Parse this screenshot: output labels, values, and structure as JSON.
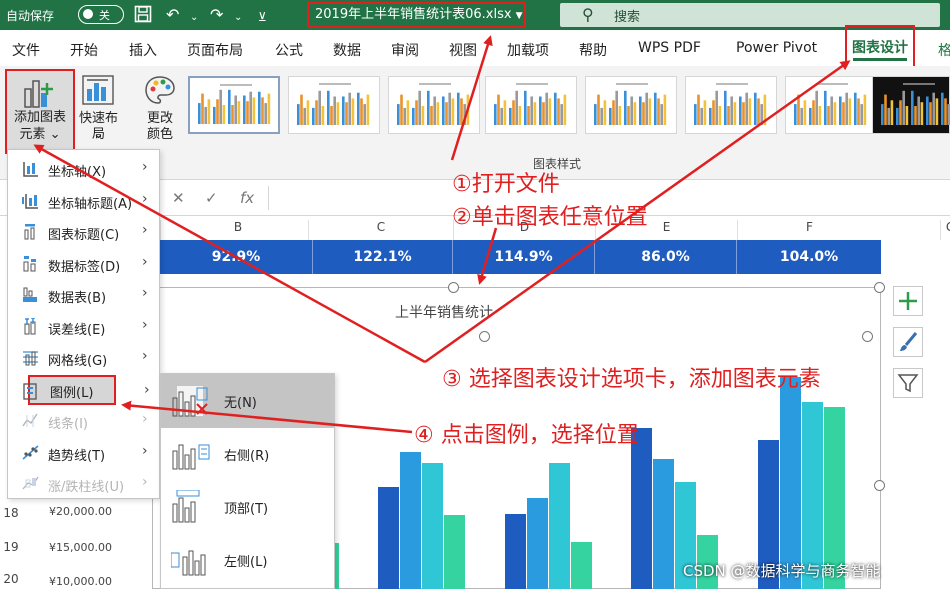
{
  "titlebar": {
    "autosave_label": "自动保存",
    "autosave_state": "关",
    "filename": "2019年上半年销售统计表06.xlsx",
    "search_placeholder": "搜索"
  },
  "tabs": [
    "文件",
    "开始",
    "插入",
    "页面布局",
    "公式",
    "数据",
    "审阅",
    "视图",
    "加载项",
    "帮助",
    "WPS PDF",
    "Power Pivot"
  ],
  "active_tab": "图表设计",
  "partial_tab": "格",
  "ribbon": {
    "add_element_label_line1": "添加图表",
    "add_element_label_line2": "元素",
    "quick_layout_label": "快速布局",
    "change_color_line1": "更改",
    "change_color_line2": "颜色",
    "styles_group_label": "图表样式"
  },
  "formula_bar": {
    "cancel_symbol": "✕",
    "confirm_symbol": "✓",
    "fx_symbol": "fx"
  },
  "sheet": {
    "column_headers": [
      "B",
      "C",
      "D",
      "E",
      "F",
      "G"
    ],
    "row_values": [
      "92.9%",
      "122.1%",
      "114.9%",
      "86.0%",
      "104.0%"
    ],
    "row_numbers": [
      "18",
      "19",
      "20"
    ],
    "y_axis_ticks": [
      "¥20,000.00",
      "¥15,000.00",
      "¥10,000.00"
    ]
  },
  "chart": {
    "title": "上半年销售统计",
    "bar_colors": [
      "#1f5cc0",
      "#2b9be0",
      "#2fc6d6",
      "#34d3a0"
    ]
  },
  "dropdown": {
    "items": [
      {
        "label": "坐标轴(X)",
        "icon": "axis-icon",
        "enabled": true
      },
      {
        "label": "坐标轴标题(A)",
        "icon": "axis-title-icon",
        "enabled": true
      },
      {
        "label": "图表标题(C)",
        "icon": "chart-title-icon",
        "enabled": true
      },
      {
        "label": "数据标签(D)",
        "icon": "data-label-icon",
        "enabled": true
      },
      {
        "label": "数据表(B)",
        "icon": "data-table-icon",
        "enabled": true
      },
      {
        "label": "误差线(E)",
        "icon": "error-bar-icon",
        "enabled": true
      },
      {
        "label": "网格线(G)",
        "icon": "gridlines-icon",
        "enabled": true
      },
      {
        "label": "图例(L)",
        "icon": "legend-icon",
        "enabled": true
      },
      {
        "label": "线条(I)",
        "icon": "lines-icon",
        "enabled": false
      },
      {
        "label": "趋势线(T)",
        "icon": "trendline-icon",
        "enabled": true
      },
      {
        "label": "涨/跌柱线(U)",
        "icon": "up-down-bars-icon",
        "enabled": false
      }
    ]
  },
  "legend_submenu": {
    "items": [
      {
        "label": "无(N)",
        "icon": "legend-none-icon",
        "selected": true
      },
      {
        "label": "右侧(R)",
        "icon": "legend-right-icon",
        "selected": false
      },
      {
        "label": "顶部(T)",
        "icon": "legend-top-icon",
        "selected": false
      },
      {
        "label": "左侧(L)",
        "icon": "legend-left-icon",
        "selected": false
      }
    ]
  },
  "annotations": {
    "step1": "①打开文件",
    "step2": "②单击图表任意位置",
    "step3": "③ 选择图表设计选项卡，添加图表元素",
    "step4": "④ 点击图例，选择位置",
    "color": "#e02020"
  },
  "watermark": "CSDN @数据科学与商务智能"
}
